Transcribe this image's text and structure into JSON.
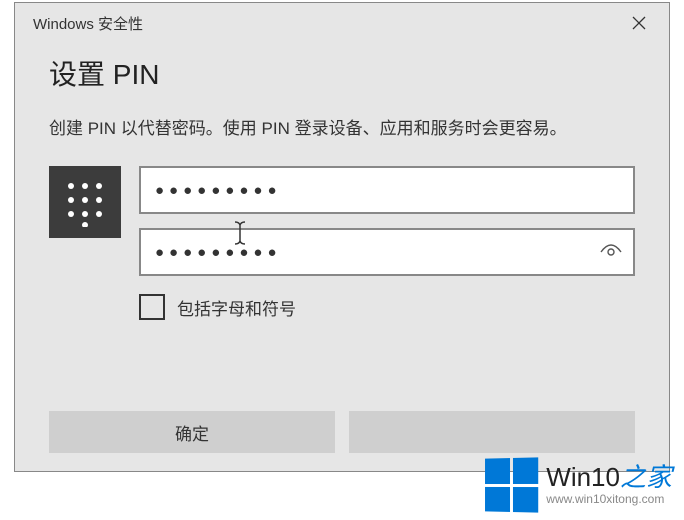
{
  "titlebar": {
    "title": "Windows 安全性"
  },
  "dialog": {
    "heading": "设置 PIN",
    "description": "创建 PIN 以代替密码。使用 PIN 登录设备、应用和服务时会更容易。"
  },
  "form": {
    "pin_value": "●●●●●●●●●",
    "confirm_value": "●●●●●●●●●",
    "checkbox_label": "包括字母和符号",
    "checkbox_checked": false
  },
  "buttons": {
    "ok": "确定",
    "cancel": ""
  },
  "watermark": {
    "brand_plain": "Win10",
    "brand_accent": "之家",
    "url": "www.win10xitong.com"
  }
}
